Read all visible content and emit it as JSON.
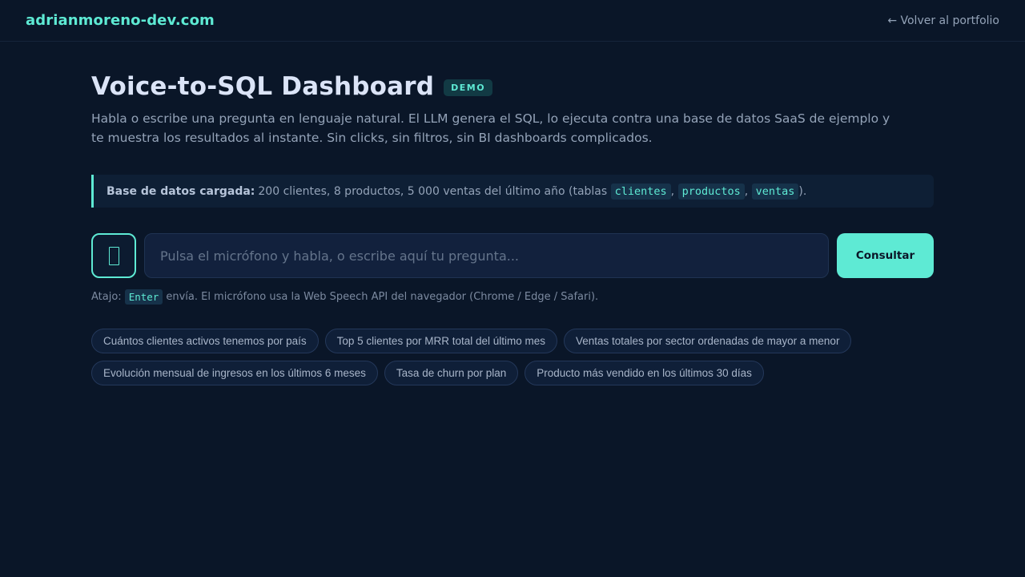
{
  "header": {
    "brand": "adrianmoreno-dev.com",
    "back_link": "← Volver al portfolio"
  },
  "main": {
    "title": "Voice-to-SQL Dashboard",
    "badge": "DEMO",
    "intro": "Habla o escribe una pregunta en lenguaje natural. El LLM genera el SQL, lo ejecuta contra una base de datos SaaS de ejemplo y te muestra los resultados al instante. Sin clicks, sin filtros, sin BI dashboards complicados."
  },
  "db_notice": {
    "label": "Base de datos cargada:",
    "text": "200 clientes, 8 productos, 5 000 ventas del último año (tablas",
    "tables": [
      "clientes",
      "productos",
      "ventas"
    ],
    "sep1": ",",
    "sep2": ",",
    "suffix": ")."
  },
  "query": {
    "mic_icon": "microphone-icon",
    "placeholder": "Pulsa el micrófono y habla, o escribe aquí tu pregunta...",
    "value": "",
    "submit_label": "Consultar"
  },
  "hint": {
    "prefix": "Atajo:",
    "key": "Enter",
    "text": "envía. El micrófono usa la Web Speech API del navegador (Chrome / Edge / Safari)."
  },
  "suggestions": [
    "Cuántos clientes activos tenemos por país",
    "Top 5 clientes por MRR total del último mes",
    "Ventas totales por sector ordenadas de mayor a menor",
    "Evolución mensual de ingresos en los últimos 6 meses",
    "Tasa de churn por plan",
    "Producto más vendido en los últimos 30 días"
  ],
  "colors": {
    "background": "#0a1628",
    "accent": "#5eead4",
    "text_muted": "#94a3b8"
  }
}
